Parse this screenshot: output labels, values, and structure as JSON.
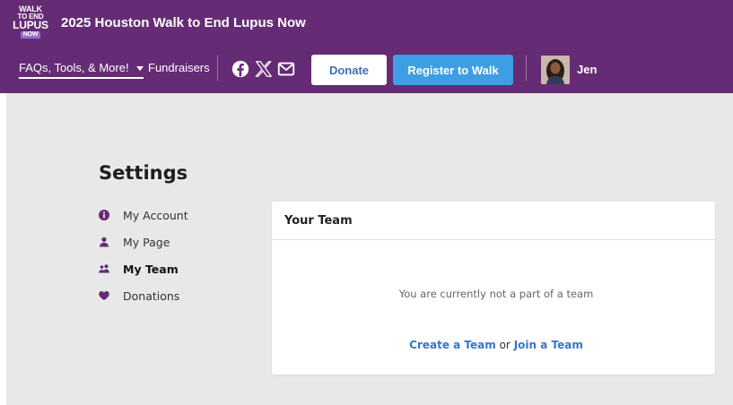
{
  "header": {
    "logo": {
      "line1": "WALK",
      "line2": "TO END",
      "line3": "LUPUS",
      "line4": "NOW"
    },
    "site_title": "2025 Houston Walk to End Lupus Now",
    "nav": {
      "faq_label": "FAQs, Tools, & More!",
      "fundraisers_label": "Fundraisers"
    },
    "social": [
      "facebook-icon",
      "x-icon",
      "mail-icon"
    ],
    "donate_label": "Donate",
    "register_label": "Register to Walk",
    "user_name": "Jen"
  },
  "settings": {
    "title": "Settings",
    "menu": [
      {
        "label": "My Account",
        "icon": "info-circle-icon",
        "active": false
      },
      {
        "label": "My Page",
        "icon": "user-icon",
        "active": false
      },
      {
        "label": "My Team",
        "icon": "users-icon",
        "active": true
      },
      {
        "label": "Donations",
        "icon": "heart-icon",
        "active": false
      }
    ]
  },
  "team_card": {
    "title": "Your Team",
    "empty_message": "You are currently not a part of a team",
    "create_label": "Create a Team",
    "or_label": "or",
    "join_label": "Join a Team"
  },
  "colors": {
    "header_bg": "#652c75",
    "accent_blue": "#3e9ee3",
    "link_blue": "#3775c9",
    "icon_purple": "#652c75",
    "page_bg": "#e8e8e8"
  }
}
